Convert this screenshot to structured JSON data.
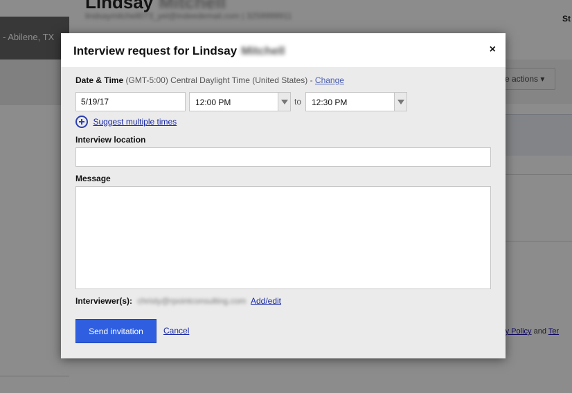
{
  "background": {
    "candidate_name": "Lindsay",
    "candidate_name_hidden": "Mitchell",
    "candidate_contact": "lindsaymitchell073_yel@indeedemail.com | 3259999911",
    "location": "- Abilene, TX",
    "status_label": "St",
    "more_actions_label": "e actions",
    "footer_link": "acy Policy",
    "footer_and": "and",
    "footer_terms": "Ter"
  },
  "modal": {
    "title": "Interview request for Lindsay",
    "title_hidden_name": "Mitchell",
    "close_label": "×",
    "date_time": {
      "label": "Date & Time",
      "timezone": "(GMT-5:00) Central Daylight Time (United States) -",
      "change_label": "Change",
      "date_value": "5/19/17",
      "start_time": "12:00 PM",
      "to_label": "to",
      "end_time": "12:30 PM"
    },
    "suggest_label": "Suggest multiple times",
    "location": {
      "label": "Interview location",
      "value": ""
    },
    "message": {
      "label": "Message",
      "value": ""
    },
    "interviewers": {
      "label": "Interviewer(s):",
      "email": "christy@rpointconsulting.com",
      "add_edit_label": "Add/edit"
    },
    "send_label": "Send invitation",
    "cancel_label": "Cancel"
  }
}
